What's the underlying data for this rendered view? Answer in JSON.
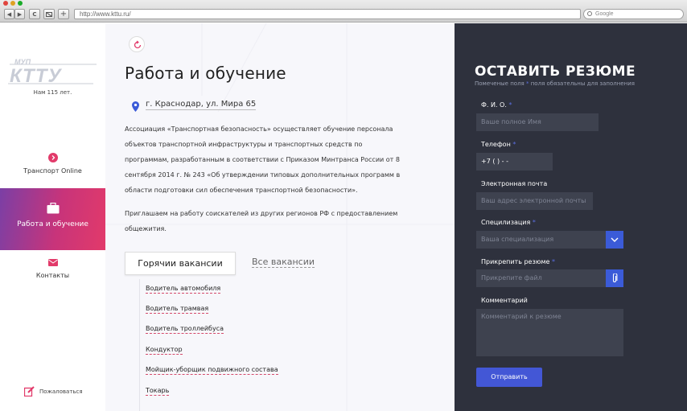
{
  "browser": {
    "url": "http://www.kttu.ru/",
    "search_placeholder": "Google",
    "back_icon": "◀",
    "forward_icon": "▶",
    "reload_icon": "C",
    "add_icon": "+"
  },
  "sidebar": {
    "logo_text": "МУП КТТУ",
    "age_text": "Нам 115 лет.",
    "items": [
      {
        "label": "Транспорт Online",
        "icon": "arrow-circle-icon"
      },
      {
        "label": "Работа и обучение",
        "icon": "briefcase-icon"
      },
      {
        "label": "Контакты",
        "icon": "envelope-icon"
      }
    ],
    "complain_label": "Пожаловаться",
    "accent_color": "#e23a6a"
  },
  "main": {
    "title": "Работа и обучение",
    "address": "г. Краснодар, ул. Мира 65",
    "paragraph1_lines": [
      "Ассоциация «Транспортная безопасность» осуществляет обучение персонала",
      "объектов транспортной инфраструктуры и транспортных средств по",
      "программам, разработанным в соответствии с Приказом Минтранса России от 8",
      "сентября 2014 г. № 243 «Об утверждении типовых дополнительных программ в",
      "области подготовки сил обеспечения транспортной безопасности»."
    ],
    "paragraph2_lines": [
      "Приглашаем на работу соискателей из других регионов РФ с предоставлением",
      "общежития."
    ],
    "tabs": [
      {
        "label": "Горячии вакансии",
        "active": true
      },
      {
        "label": "Все вакансии",
        "active": false
      }
    ],
    "vacancies": [
      "Водитель автомобиля",
      "Водитель трамвая",
      "Водитель троллейбуса",
      "Кондуктор",
      "Мойщик-уборщик подвижного состава",
      "Токарь"
    ]
  },
  "form": {
    "title": "ОСТАВИТЬ РЕЗЮМЕ",
    "subtitle_before": "Помеченые поля",
    "subtitle_star": "*",
    "subtitle_after": "поля обязательны для заполнения",
    "fields": {
      "name": {
        "label": "Ф. И. О.",
        "required": "*",
        "placeholder": "Ваше полное Имя"
      },
      "phone": {
        "label": "Телефон",
        "required": "*",
        "value": "+7 (    )   -  -"
      },
      "email": {
        "label": "Электронная почта",
        "placeholder": "Ваш адрес электронной почты"
      },
      "specialization": {
        "label": "Специлизация",
        "required": "*",
        "placeholder": "Ваша специализация"
      },
      "resume": {
        "label": "Прикрепить резюме",
        "required": "*",
        "placeholder": "Прикрепите файл"
      },
      "comment": {
        "label": "Комментарий",
        "placeholder": "Комментарий к резюме"
      }
    },
    "submit_label": "Отправить",
    "accent_color": "#4357d6"
  }
}
